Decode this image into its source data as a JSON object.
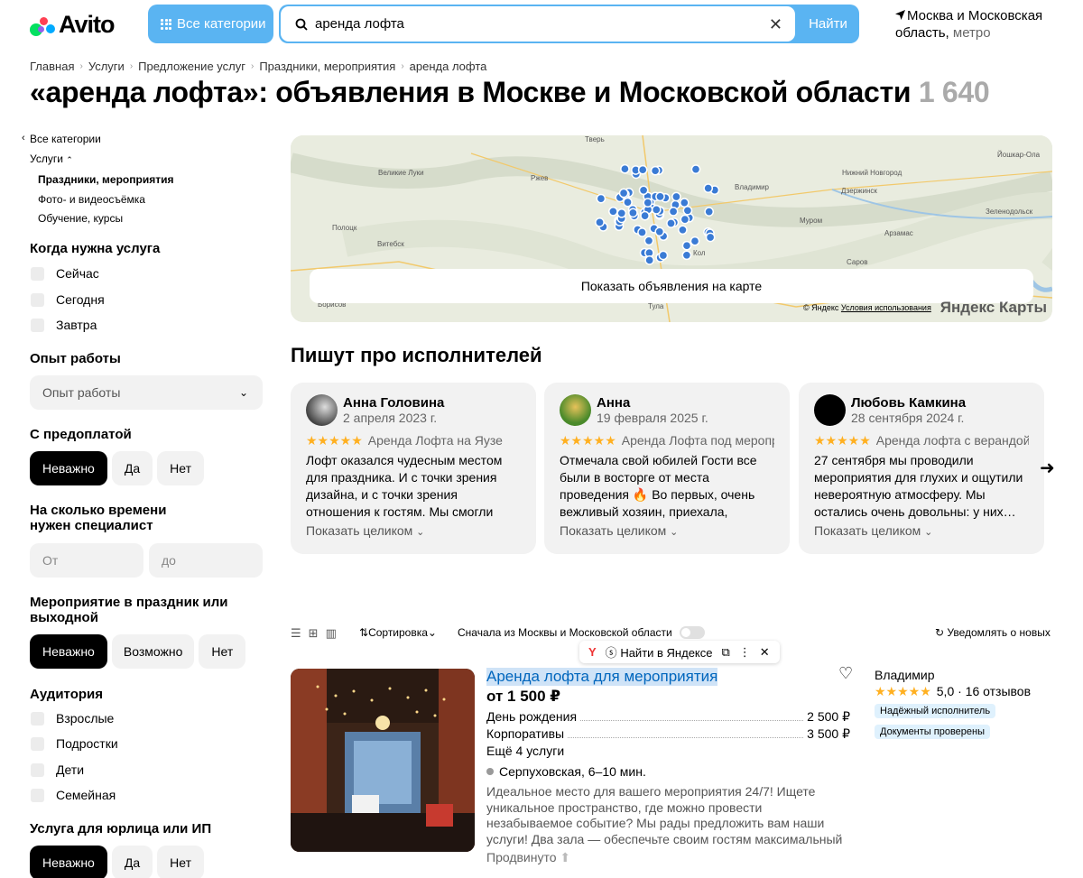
{
  "header": {
    "logo_text": "Avito",
    "categories_label": "Все категории",
    "search_value": "аренда лофта",
    "search_button": "Найти",
    "location_main": "Москва и Московская область,",
    "location_metro": "метро"
  },
  "breadcrumb": [
    "Главная",
    "Услуги",
    "Предложение услуг",
    "Праздники, мероприятия",
    "аренда лофта"
  ],
  "title": {
    "text": "«аренда лофта»: объявления в Москве и Московской области",
    "count": "1 640"
  },
  "sidebar": {
    "all_categories": "Все категории",
    "services": "Услуги",
    "sub_items": [
      "Праздники, мероприятия",
      "Фото- и видеосъёмка",
      "Обучение, курсы"
    ],
    "when_title": "Когда нужна услуга",
    "when_options": [
      "Сейчас",
      "Сегодня",
      "Завтра"
    ],
    "experience_title": "Опыт работы",
    "experience_placeholder": "Опыт работы",
    "prepay_title": "С предоплатой",
    "prepay_options": [
      "Неважно",
      "Да",
      "Нет"
    ],
    "duration_title": "На сколько времени нужен специалист",
    "duration_from": "От",
    "duration_to": "до",
    "holiday_title": "Мероприятие в праздник или выходной",
    "holiday_options": [
      "Неважно",
      "Возможно",
      "Нет"
    ],
    "audience_title": "Аудитория",
    "audience_options": [
      "Взрослые",
      "Подростки",
      "Дети",
      "Семейная"
    ],
    "legal_title": "Услуга для юрлица или ИП",
    "legal_options": [
      "Неважно",
      "Да",
      "Нет"
    ]
  },
  "map": {
    "button": "Показать объявления на карте",
    "copyright": "© Яндекс",
    "terms": "Условия использования",
    "logo": "Яндекс Карты",
    "cities": [
      "Тверь",
      "Великие Луки",
      "Ржев",
      "Владимир",
      "Нижний Новгород",
      "Дзержинск",
      "Йошкар-Ола",
      "Полоцк",
      "Витебск",
      "Муром",
      "Арзамас",
      "Саров",
      "Борисов",
      "Тула",
      "Зеленодольск",
      "Кол"
    ]
  },
  "reviews": {
    "title": "Пишут про исполнителей",
    "items": [
      {
        "name": "Анна Головина",
        "date": "2 апреля 2023 г.",
        "stars": "★★★★★",
        "subject": "Аренда Лофта на Яузе",
        "text": "Лофт оказался чудесным местом для праздника. И с точки зрения дизайна, и с точки зрения отношения к гостям. Мы смогли прекрасно провести…",
        "more": "Показать целиком"
      },
      {
        "name": "Анна",
        "date": "19 февраля 2025 г.",
        "stars": "★★★★★",
        "subject": "Аренда Лофта под мероприятия",
        "text": "Отмечала свой юбилей Гости все были в восторге от места проведения 🔥 Во первых, очень вежливый хозяин, приехала, показал все, сразу…",
        "more": "Показать целиком"
      },
      {
        "name": "Любовь Камкина",
        "date": "28 сентября 2024 г.",
        "stars": "★★★★★",
        "subject": "Аренда лофта с верандой",
        "text": "27 сентября мы проводили мероприятия для глухих и ощутили невероятную атмосферу. Мы остались очень довольны: у них…",
        "more": "Показать целиком"
      }
    ]
  },
  "toolbar": {
    "sort": "Сортировка",
    "moscow_first": "Сначала из Москвы и Московской области",
    "notify": "Уведомлять о новых",
    "ya_search": "Найти в Яндексе"
  },
  "listing": {
    "title": "Аренда лофта для мероприятия",
    "price": "от 1 500 ₽",
    "services": [
      {
        "name": "День рождения",
        "price": "2 500 ₽"
      },
      {
        "name": "Корпоративы",
        "price": "3 500 ₽"
      }
    ],
    "more_services": "Ещё 4 услуги",
    "metro": "Серпуховская, 6–10 мин.",
    "description": "Идеальное место для вашего мероприятия 24/7! Ищете уникальное пространство, где можно провести незабываемое событие? Мы рады предложить вам наши услуги! Два зала — обеспечьте своим гостям максимальный комфорт! Сцена для…",
    "promo": "Продвинуто",
    "seller_name": "Владимир",
    "seller_stars": "★★★★★",
    "seller_rating": "5,0 · 16 отзывов",
    "badges": [
      "Надёжный исполнитель",
      "Документы проверены"
    ]
  },
  "colors": {
    "accent": "#5ab4f2",
    "link": "#0066bd",
    "star": "#ffb021",
    "map_dot": "#3a7bd5"
  }
}
